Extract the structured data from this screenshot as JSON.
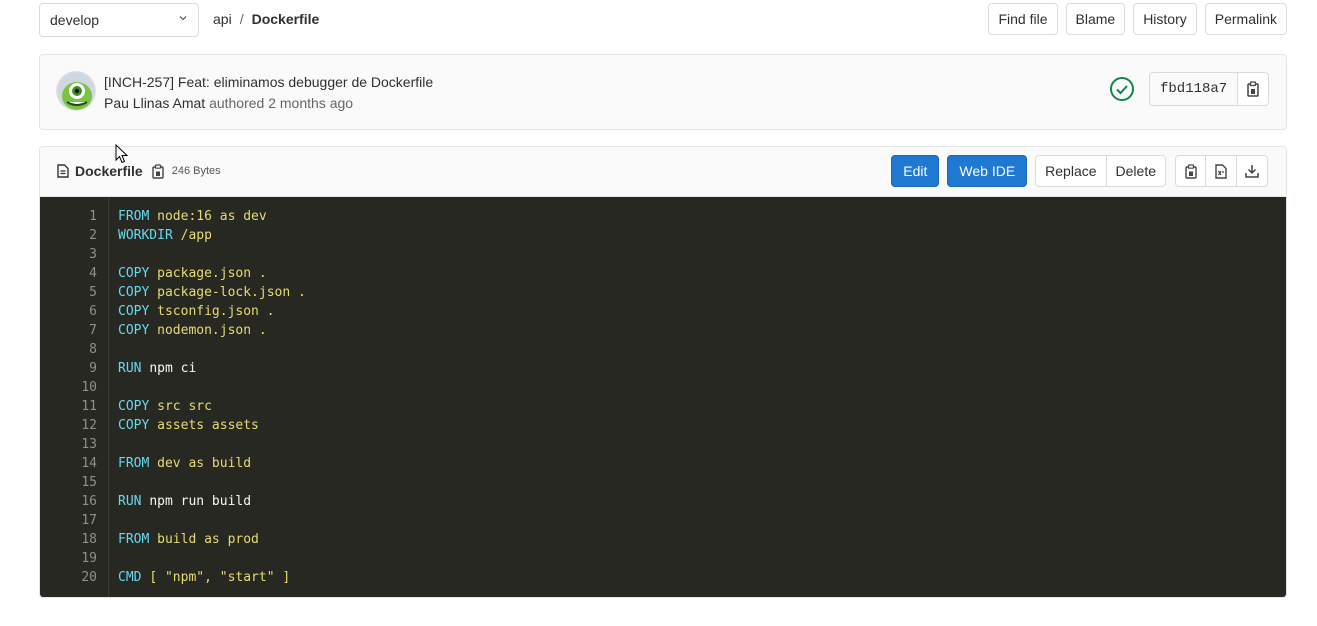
{
  "branch": {
    "value": "develop"
  },
  "breadcrumb": {
    "root": "api",
    "separator": "/",
    "file": "Dockerfile"
  },
  "top_buttons": [
    "Find file",
    "Blame",
    "History",
    "Permalink"
  ],
  "commit": {
    "title": "[INCH-257] Feat: eliminamos debugger de Dockerfile",
    "author": "Pau Llinas Amat",
    "authored_text": "authored 2 months ago",
    "sha": "fbd118a7",
    "pipeline_status": "passed"
  },
  "file": {
    "name": "Dockerfile",
    "size": "246 Bytes",
    "edit_label": "Edit",
    "webide_label": "Web IDE",
    "replace_label": "Replace",
    "delete_label": "Delete"
  },
  "code_lines": [
    {
      "kw": "FROM",
      "rest": "node:16 as dev",
      "style": "str"
    },
    {
      "kw": "WORKDIR",
      "rest": "/app",
      "style": "str"
    },
    {
      "kw": "",
      "rest": "",
      "style": "plain"
    },
    {
      "kw": "COPY",
      "rest": "package.json .",
      "style": "str"
    },
    {
      "kw": "COPY",
      "rest": "package-lock.json .",
      "style": "str"
    },
    {
      "kw": "COPY",
      "rest": "tsconfig.json .",
      "style": "str"
    },
    {
      "kw": "COPY",
      "rest": "nodemon.json .",
      "style": "str"
    },
    {
      "kw": "",
      "rest": "",
      "style": "plain"
    },
    {
      "kw": "RUN",
      "rest": "npm ci",
      "style": "plain"
    },
    {
      "kw": "",
      "rest": "",
      "style": "plain"
    },
    {
      "kw": "COPY",
      "rest": "src src",
      "style": "str"
    },
    {
      "kw": "COPY",
      "rest": "assets assets",
      "style": "str"
    },
    {
      "kw": "",
      "rest": "",
      "style": "plain"
    },
    {
      "kw": "FROM",
      "rest": "dev as build",
      "style": "str"
    },
    {
      "kw": "",
      "rest": "",
      "style": "plain"
    },
    {
      "kw": "RUN",
      "rest": "npm run build",
      "style": "plain"
    },
    {
      "kw": "",
      "rest": "",
      "style": "plain"
    },
    {
      "kw": "FROM",
      "rest": "build as prod",
      "style": "str"
    },
    {
      "kw": "",
      "rest": "",
      "style": "plain"
    },
    {
      "kw": "CMD",
      "rest": "[ \"npm\", \"start\" ]",
      "style": "str"
    }
  ],
  "colors": {
    "editor_bg": "#272822",
    "keyword": "#66d9ef",
    "string": "#e6db74",
    "primary": "#1f78d1",
    "success": "#108548"
  }
}
